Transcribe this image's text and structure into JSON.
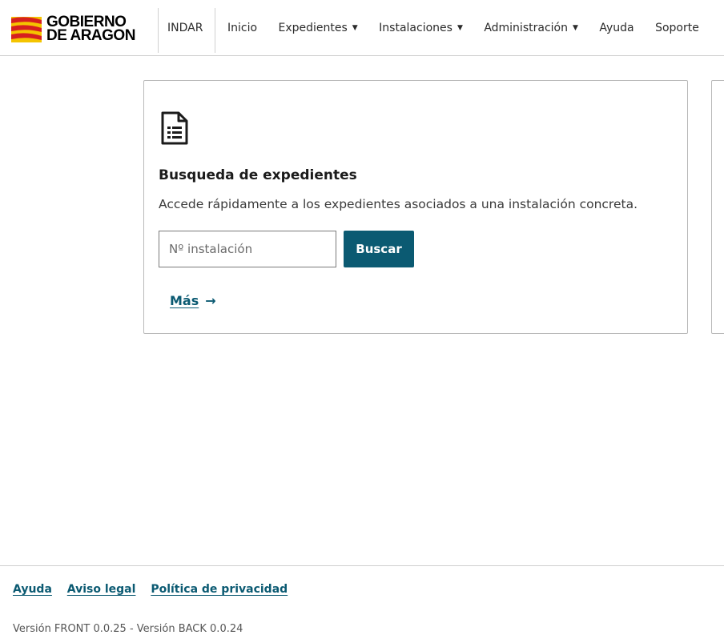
{
  "header": {
    "logo": {
      "line1": "GOBIERNO",
      "line2": "DE ARAGON"
    },
    "app_name": "INDAR",
    "nav": [
      {
        "label": "Inicio",
        "dropdown": false
      },
      {
        "label": "Expedientes",
        "dropdown": true
      },
      {
        "label": "Instalaciones",
        "dropdown": true
      },
      {
        "label": "Administración",
        "dropdown": true
      },
      {
        "label": "Ayuda",
        "dropdown": false
      },
      {
        "label": "Soporte",
        "dropdown": false
      }
    ]
  },
  "card": {
    "icon": "document-list-icon",
    "title": "Busqueda de expedientes",
    "description": "Accede rápidamente a los expedientes asociados a una instalación concreta.",
    "input_value": "",
    "input_placeholder": "Nº instalación",
    "button_label": "Buscar",
    "more_label": "Más",
    "more_arrow": "→"
  },
  "footer": {
    "links": [
      "Ayuda",
      "Aviso legal",
      "Política de privacidad"
    ],
    "version": "Versión FRONT 0.0.25 - Versión BACK 0.0.24"
  },
  "colors": {
    "primary": "#0b5a72",
    "logo_red": "#d6201f",
    "logo_yellow": "#f4c400",
    "border": "#b9b9b9"
  }
}
